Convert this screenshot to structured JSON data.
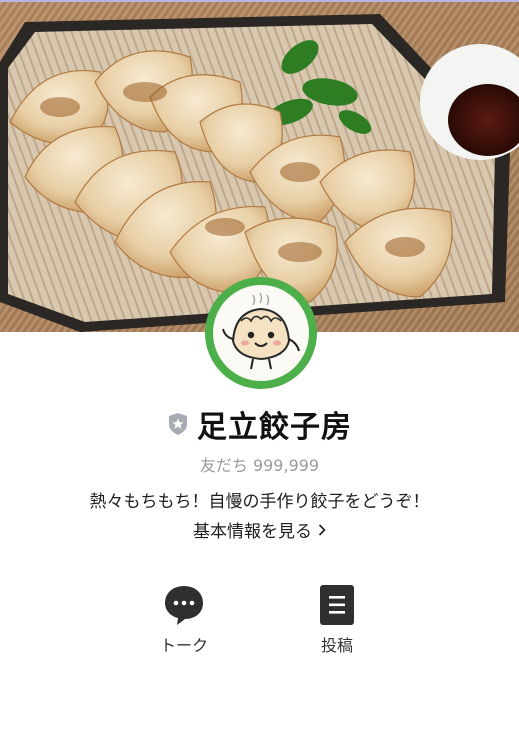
{
  "profile": {
    "name": "足立餃子房",
    "friends_text": "友だち 999,999",
    "status_message": "熱々もちもち！自慢の手作り餃子をどうぞ！",
    "info_link_label": "基本情報を見る"
  },
  "actions": [
    {
      "label": "トーク",
      "icon": "chat-bubble-icon"
    },
    {
      "label": "投稿",
      "icon": "post-document-icon"
    }
  ],
  "colors": {
    "avatar_ring": "#4daf4a",
    "badge": "#a7acb4",
    "action_icon": "#2f2f2f"
  }
}
